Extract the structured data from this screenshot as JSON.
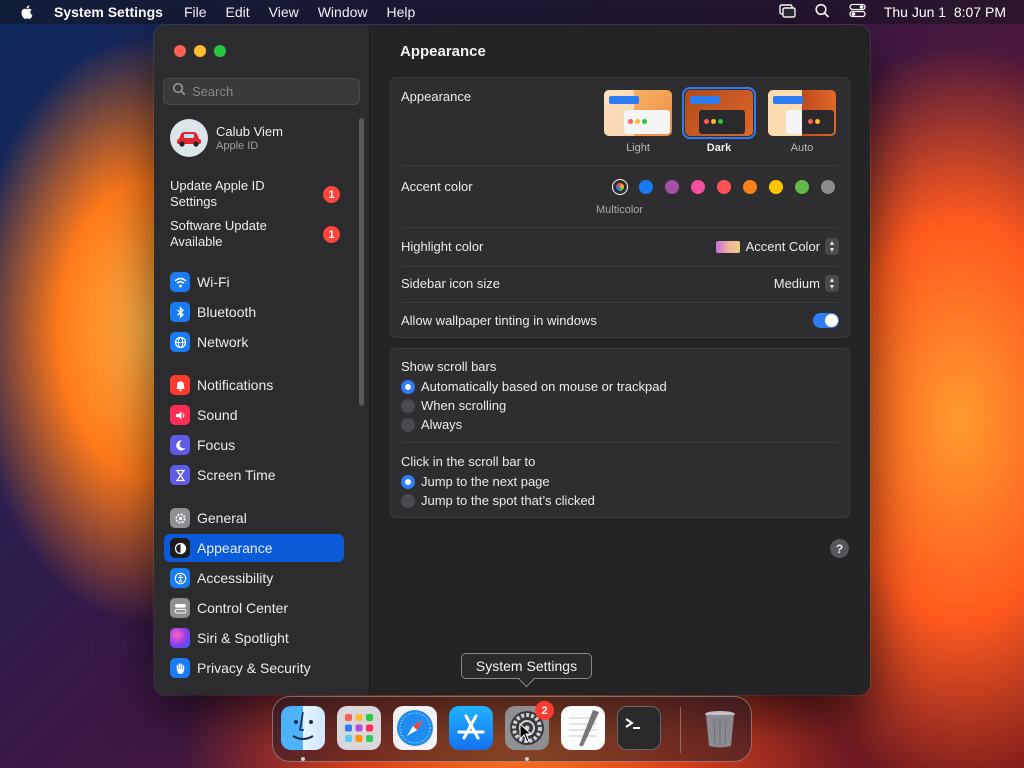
{
  "menubar": {
    "app_name": "System Settings",
    "menus": [
      "File",
      "Edit",
      "View",
      "Window",
      "Help"
    ],
    "clock": "Thu Jun 1  8:07 PM"
  },
  "sidebar": {
    "search_placeholder": "Search",
    "profile": {
      "name": "Calub Viem",
      "subtitle": "Apple ID"
    },
    "notices": [
      {
        "label": "Update Apple ID Settings",
        "badge": "1"
      },
      {
        "label": "Software Update Available",
        "badge": "1"
      }
    ],
    "items": [
      {
        "label": "Wi-Fi",
        "icon": "wifi-icon",
        "color": "#1a7cf5"
      },
      {
        "label": "Bluetooth",
        "icon": "bluetooth-icon",
        "color": "#1a7cf5"
      },
      {
        "label": "Network",
        "icon": "globe-icon",
        "color": "#1a7cf5"
      },
      {
        "label": "Notifications",
        "icon": "bell-icon",
        "color": "#ff3b30"
      },
      {
        "label": "Sound",
        "icon": "speaker-icon",
        "color": "#ff2d55"
      },
      {
        "label": "Focus",
        "icon": "moon-icon",
        "color": "#5e5ce6"
      },
      {
        "label": "Screen Time",
        "icon": "hourglass-icon",
        "color": "#5e5ce6"
      },
      {
        "label": "General",
        "icon": "gear-icon",
        "color": "#8e8e93"
      },
      {
        "label": "Appearance",
        "icon": "appearance-icon",
        "color": "#1c1c1e"
      },
      {
        "label": "Accessibility",
        "icon": "accessibility-icon",
        "color": "#1a7cf5"
      },
      {
        "label": "Control Center",
        "icon": "control-center-icon",
        "color": "#8e8e93"
      },
      {
        "label": "Siri & Spotlight",
        "icon": "siri-icon",
        "color": "#b44ce0"
      },
      {
        "label": "Privacy & Security",
        "icon": "hand-icon",
        "color": "#1a7cf5"
      }
    ]
  },
  "content": {
    "title": "Appearance",
    "appearance": {
      "label": "Appearance",
      "options": [
        {
          "label": "Light",
          "selected": false
        },
        {
          "label": "Dark",
          "selected": true
        },
        {
          "label": "Auto",
          "selected": false
        }
      ]
    },
    "accent": {
      "label": "Accent color",
      "multicolor_label": "Multicolor",
      "colors": [
        "#9a9a9a",
        "#1a7cf5",
        "#a550a7",
        "#f74f9e",
        "#ff5257",
        "#f7821b",
        "#ffc600",
        "#62ba46",
        "#8c8c8c"
      ]
    },
    "highlight": {
      "label": "Highlight color",
      "value": "Accent Color"
    },
    "icon_size": {
      "label": "Sidebar icon size",
      "value": "Medium"
    },
    "tinting": {
      "label": "Allow wallpaper tinting in windows",
      "on": true
    },
    "scroll_bars": {
      "label": "Show scroll bars",
      "options": [
        {
          "label": "Automatically based on mouse or trackpad",
          "selected": true
        },
        {
          "label": "When scrolling",
          "selected": false
        },
        {
          "label": "Always",
          "selected": false
        }
      ]
    },
    "click_scroll": {
      "label": "Click in the scroll bar to",
      "options": [
        {
          "label": "Jump to the next page",
          "selected": true
        },
        {
          "label": "Jump to the spot that’s clicked",
          "selected": false
        }
      ]
    },
    "help": "?"
  },
  "tooltip": "System Settings",
  "dock": {
    "apps": [
      {
        "name": "finder-icon",
        "running": true
      },
      {
        "name": "launchpad-icon",
        "running": false
      },
      {
        "name": "safari-icon",
        "running": false
      },
      {
        "name": "app-store-icon",
        "running": false
      },
      {
        "name": "system-settings-icon",
        "running": true,
        "badge": "2"
      },
      {
        "name": "textedit-icon",
        "running": false
      },
      {
        "name": "terminal-icon",
        "running": false
      },
      {
        "name": "trash-icon",
        "running": false
      }
    ]
  }
}
